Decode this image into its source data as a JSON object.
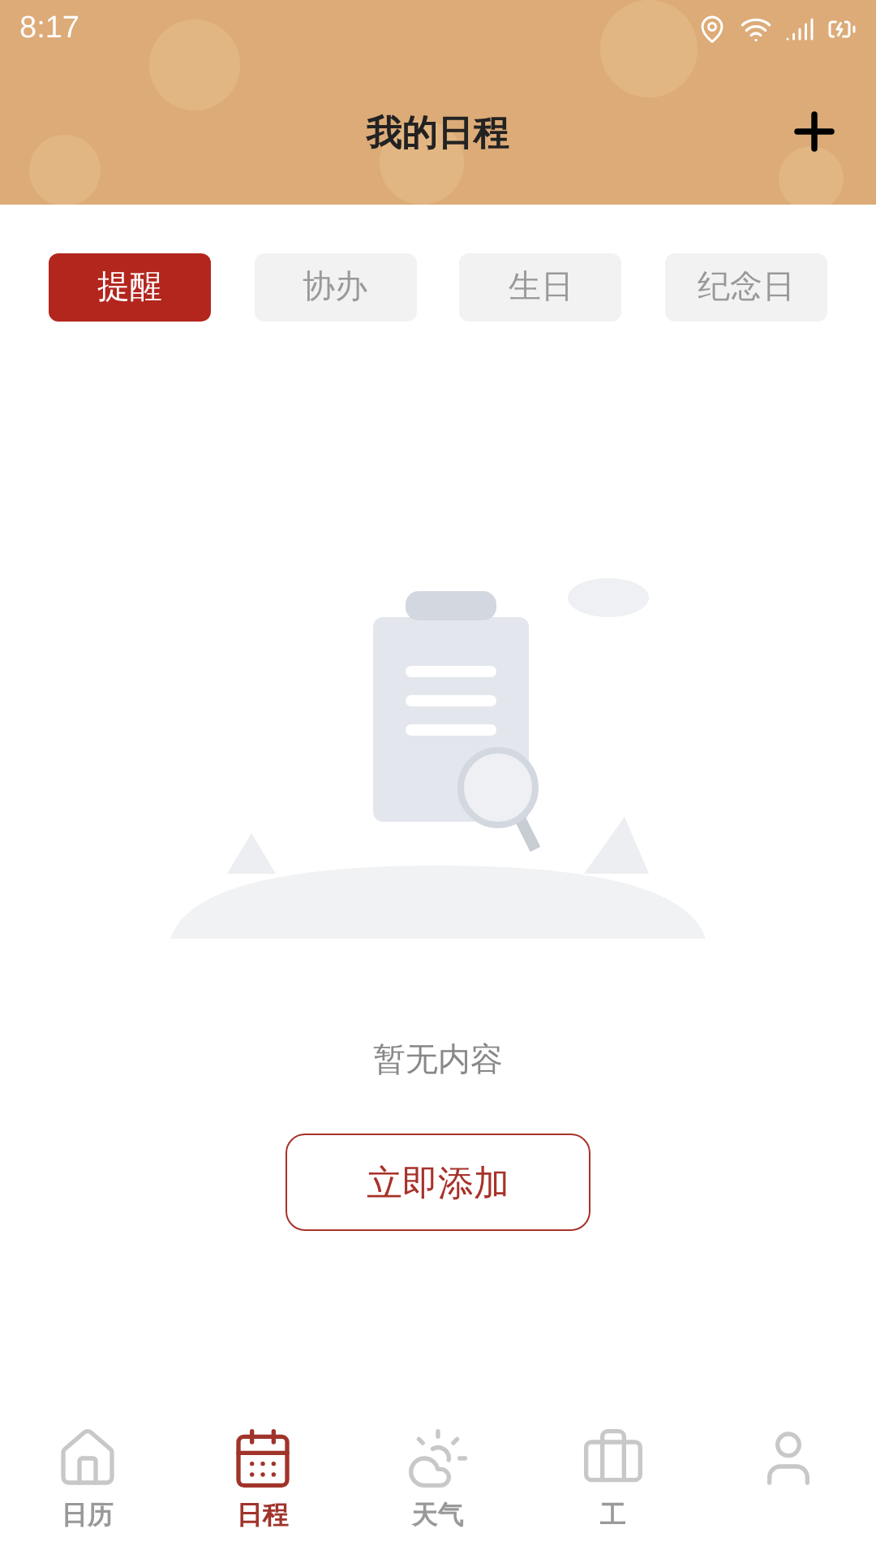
{
  "status_bar": {
    "time": "8:17"
  },
  "header": {
    "title": "我的日程"
  },
  "tabs": [
    {
      "label": "提醒",
      "selected": true
    },
    {
      "label": "协办",
      "selected": false
    },
    {
      "label": "生日",
      "selected": false
    },
    {
      "label": "纪念日",
      "selected": false
    }
  ],
  "empty_state": {
    "message": "暂无内容",
    "button": "立即添加"
  },
  "bottom_nav": [
    {
      "kind": "home",
      "label": "日历",
      "selected": false
    },
    {
      "kind": "calendar",
      "label": "日程",
      "selected": true
    },
    {
      "kind": "weather",
      "label": "天气",
      "selected": false
    },
    {
      "kind": "toolbox",
      "label": "工",
      "selected": false
    },
    {
      "kind": "profile",
      "selected": false
    }
  ]
}
